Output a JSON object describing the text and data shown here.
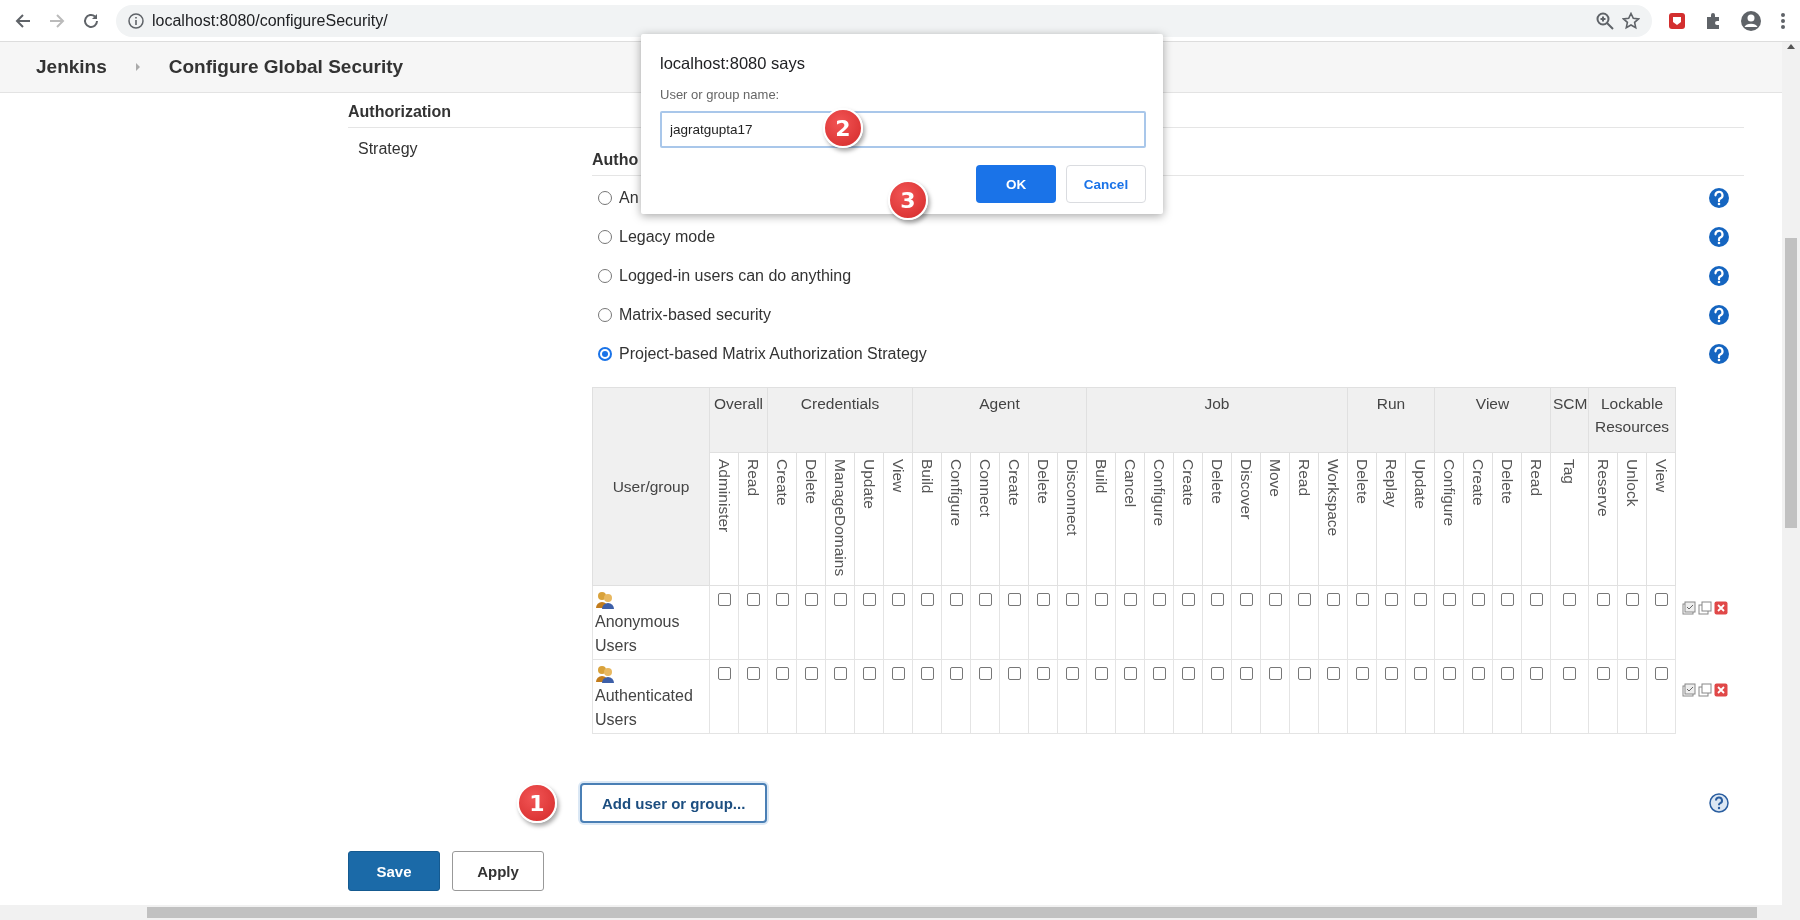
{
  "browser": {
    "url": "localhost:8080/configureSecurity/"
  },
  "breadcrumbs": [
    {
      "label": "Jenkins"
    },
    {
      "label": "Configure Global Security"
    }
  ],
  "section": {
    "title": "Authorization",
    "field_label": "Strategy",
    "heading": "Autho"
  },
  "strategies": [
    {
      "label": "An",
      "selected": false
    },
    {
      "label": "Legacy mode",
      "selected": false
    },
    {
      "label": "Logged-in users can do anything",
      "selected": false
    },
    {
      "label": "Matrix-based security",
      "selected": false
    },
    {
      "label": "Project-based Matrix Authorization Strategy",
      "selected": true
    }
  ],
  "matrix": {
    "user_column": "User/group",
    "groups": [
      {
        "label": "Overall",
        "permissions": [
          "Administer",
          "Read"
        ]
      },
      {
        "label": "Credentials",
        "permissions": [
          "Create",
          "Delete",
          "ManageDomains",
          "Update",
          "View"
        ]
      },
      {
        "label": "Agent",
        "permissions": [
          "Build",
          "Configure",
          "Connect",
          "Create",
          "Delete",
          "Disconnect"
        ]
      },
      {
        "label": "Job",
        "permissions": [
          "Build",
          "Cancel",
          "Configure",
          "Create",
          "Delete",
          "Discover",
          "Move",
          "Read",
          "Workspace"
        ]
      },
      {
        "label": "Run",
        "permissions": [
          "Delete",
          "Replay",
          "Update"
        ]
      },
      {
        "label": "View",
        "permissions": [
          "Configure",
          "Create",
          "Delete",
          "Read"
        ]
      },
      {
        "label": "SCM",
        "permissions": [
          "Tag"
        ]
      },
      {
        "label": "Lockable Resources",
        "permissions": [
          "Reserve",
          "Unlock",
          "View"
        ]
      }
    ],
    "rows": [
      {
        "name": "Anonymous Users",
        "checked": [
          false,
          false,
          false,
          false,
          false,
          false,
          false,
          false,
          false,
          false,
          false,
          false,
          false,
          false,
          false,
          false,
          false,
          false,
          false,
          false,
          false,
          false,
          false,
          false,
          false,
          false,
          false,
          false,
          false,
          false,
          false,
          false,
          false
        ]
      },
      {
        "name": "Authenticated Users",
        "checked": [
          false,
          false,
          false,
          false,
          false,
          false,
          false,
          false,
          false,
          false,
          false,
          false,
          false,
          false,
          false,
          false,
          false,
          false,
          false,
          false,
          false,
          false,
          false,
          false,
          false,
          false,
          false,
          false,
          false,
          false,
          false,
          false,
          false
        ]
      }
    ]
  },
  "add_button": "Add user or group...",
  "buttons": [
    {
      "label": "Save",
      "kind": "primary"
    },
    {
      "label": "Apply",
      "kind": "secondary"
    }
  ],
  "dialog": {
    "title": "localhost:8080 says",
    "prompt": "User or group name:",
    "value": "jagratgupta17",
    "buttons": [
      {
        "label": "OK",
        "kind": "primary"
      },
      {
        "label": "Cancel",
        "kind": "secondary"
      }
    ]
  },
  "markers": [
    {
      "number": "1"
    },
    {
      "number": "2"
    },
    {
      "number": "3"
    }
  ]
}
